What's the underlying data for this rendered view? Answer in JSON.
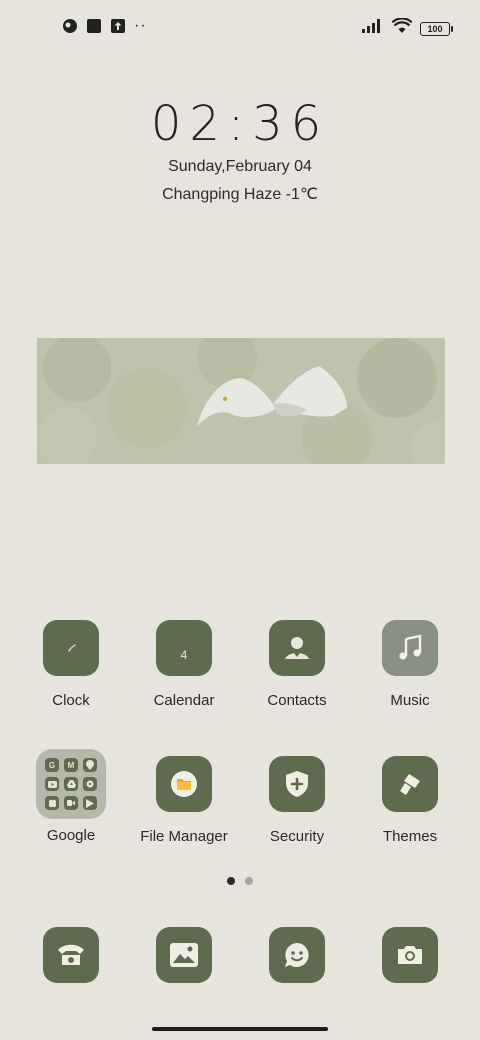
{
  "status_bar": {
    "left_icons": [
      "app-icon",
      "square-app-icon",
      "upload-icon"
    ],
    "overflow_dots": "··",
    "battery_level": "100"
  },
  "lock_clock": {
    "time": "02:36",
    "date": "Sunday,February 04",
    "weather": "Changping Haze -1℃"
  },
  "apps_row1": [
    {
      "label": "Clock",
      "icon": "clock-icon"
    },
    {
      "label": "Calendar",
      "icon": "calendar-icon",
      "glyph": "4"
    },
    {
      "label": "Contacts",
      "icon": "contacts-icon"
    },
    {
      "label": "Music",
      "icon": "music-icon"
    }
  ],
  "apps_row2": [
    {
      "label": "Google",
      "icon": "google-folder-icon"
    },
    {
      "label": "File Manager",
      "icon": "file-manager-icon"
    },
    {
      "label": "Security",
      "icon": "security-icon"
    },
    {
      "label": "Themes",
      "icon": "themes-icon"
    }
  ],
  "google_folder_items": [
    "G",
    "M",
    "",
    "",
    "",
    "",
    "",
    "",
    ""
  ],
  "page_indicator": {
    "pages": 2,
    "active": 1
  },
  "dock": [
    {
      "icon": "phone-icon"
    },
    {
      "icon": "gallery-icon"
    },
    {
      "icon": "messages-icon"
    },
    {
      "icon": "camera-icon"
    }
  ],
  "colors": {
    "background": "#e6e4dc",
    "tile": "#5e6b4f",
    "tile_muted": "#8a8f85"
  }
}
